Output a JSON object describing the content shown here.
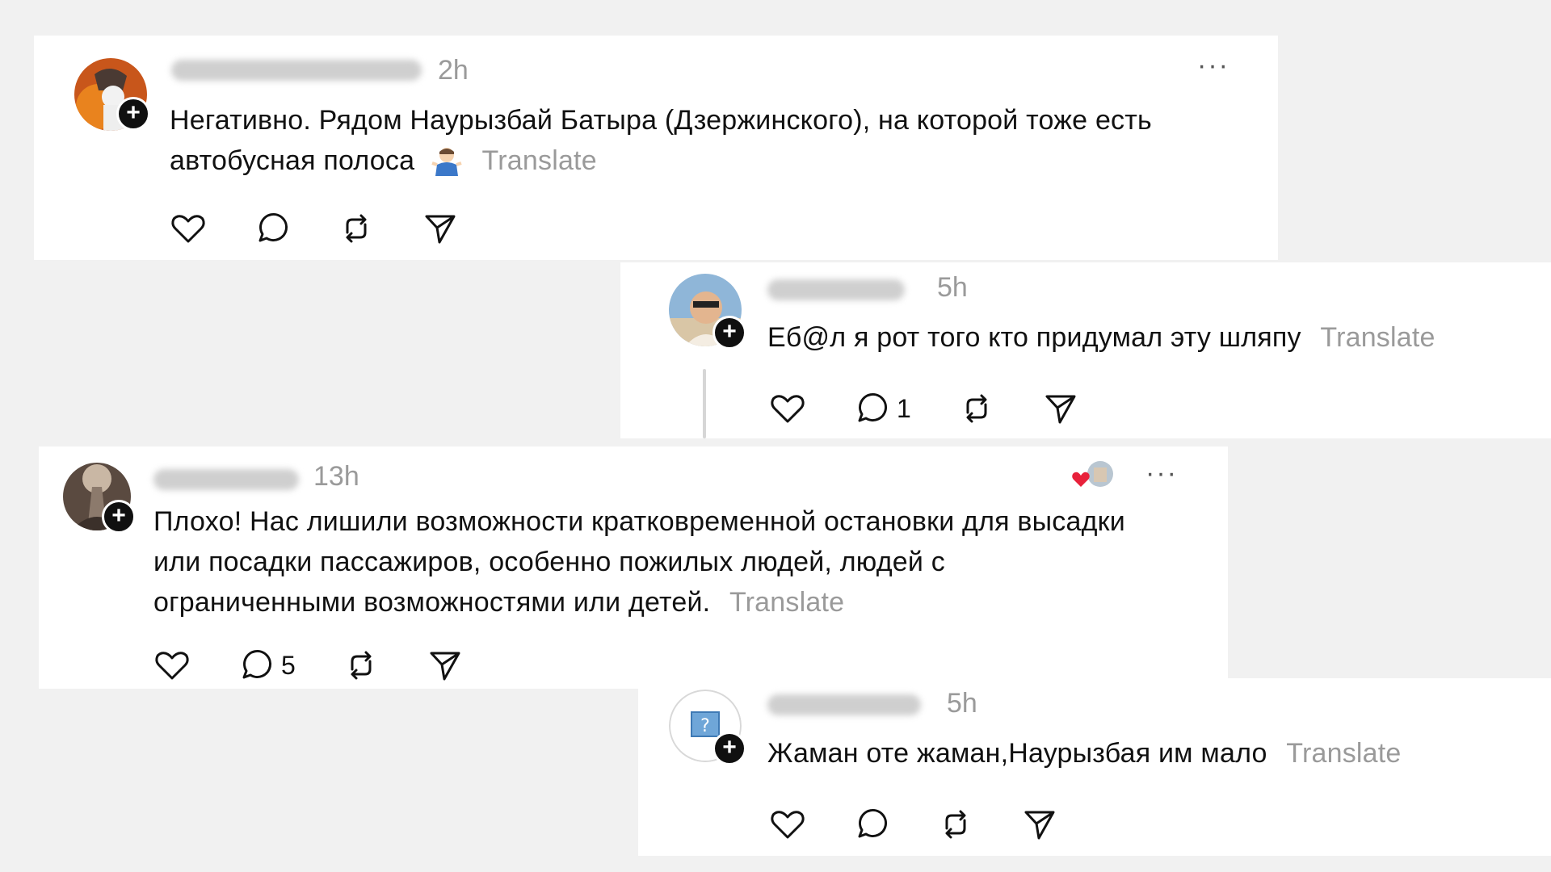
{
  "comments": [
    {
      "time": "2h",
      "text": "Негативно. Рядом Наурызбай Батыра (Дзержинского), на которой тоже есть автобусная полоса",
      "translate": "Translate",
      "more": "···"
    },
    {
      "time": "5h",
      "text": "Еб@л я рот того кто придумал эту шляпу",
      "translate": "Translate",
      "reply_count": "1"
    },
    {
      "time": "13h",
      "text": "Плохо! Нас лишили возможности кратковременной остановки для высадки или посадки пассажиров, особенно пожилых людей, людей с ограниченными возможностями или детей.",
      "translate": "Translate",
      "reply_count": "5",
      "more": "···"
    },
    {
      "time": "5h",
      "text": "Жаман оте жаман,Наурызбая им мало",
      "translate": "Translate"
    }
  ],
  "plus_symbol": "+",
  "icons": [
    "heart-icon",
    "comment-icon",
    "repost-icon",
    "share-icon",
    "plus-icon",
    "more-icon",
    "shrug-emoji-icon"
  ],
  "colors": {
    "accent_like": "#e8213b",
    "muted": "#9a9a9a",
    "text": "#111111",
    "background": "#f1f1f1"
  }
}
